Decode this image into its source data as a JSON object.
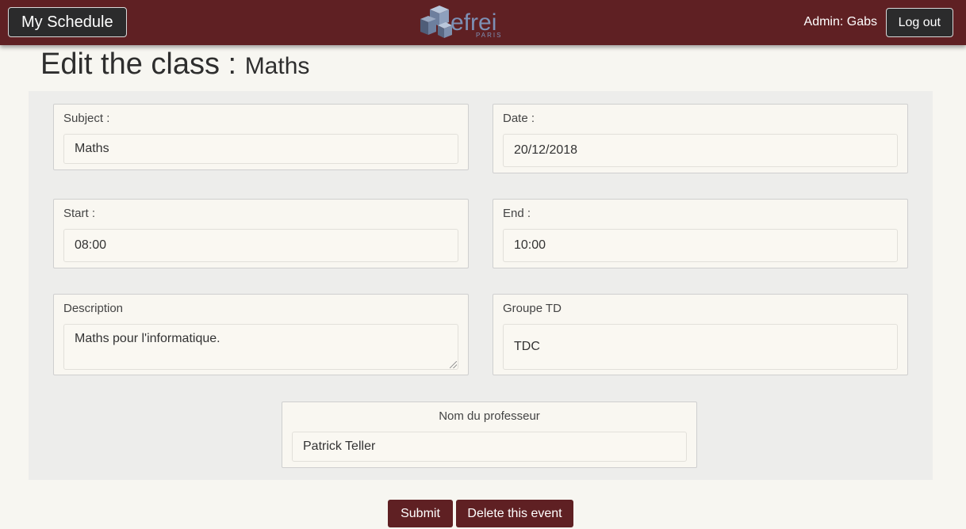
{
  "navbar": {
    "brand_label": "My Schedule",
    "logo_text": "efrei",
    "logo_subtext": "PARIS",
    "admin_text": "Admin: Gabs",
    "logout_label": "Log out"
  },
  "page": {
    "title": "Edit the class :",
    "title_subject": "Maths"
  },
  "form": {
    "subject": {
      "label": "Subject :",
      "value": "Maths"
    },
    "date": {
      "label": "Date :",
      "value": "20/12/2018"
    },
    "start": {
      "label": "Start :",
      "value": "08:00"
    },
    "end": {
      "label": "End :",
      "value": "10:00"
    },
    "description": {
      "label": "Description",
      "value": "Maths pour l'informatique."
    },
    "groupe": {
      "label": "Groupe TD",
      "value": "TDC"
    },
    "professor": {
      "label": "Nom du professeur",
      "value": "Patrick Teller"
    }
  },
  "actions": {
    "submit_label": "Submit",
    "delete_label": "Delete this event"
  },
  "colors": {
    "navbar": "#5f2023",
    "button_dark": "#2b2b2c",
    "action": "#5f2023",
    "background": "#f7f6f1",
    "form_panel": "#ededeb"
  }
}
